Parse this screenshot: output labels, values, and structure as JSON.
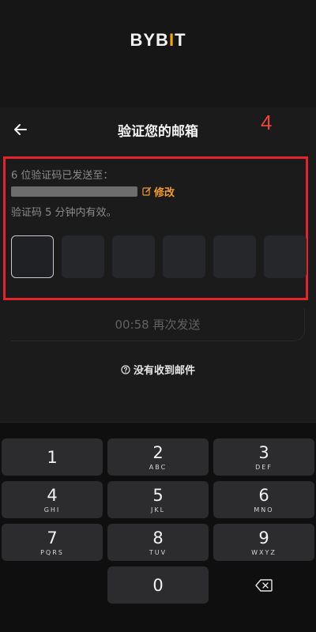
{
  "brand": {
    "logo_prefix": "BYB",
    "logo_accent": "I",
    "logo_suffix": "T"
  },
  "header": {
    "title": "验证您的邮箱",
    "annotation_number": "4"
  },
  "verification": {
    "sent_label": "6 位验证码已发送至：",
    "edit_label": "修改",
    "validity_note": "验证码 5 分钟内有效。",
    "code_length": 6
  },
  "resend": {
    "label": "00:58 再次发送"
  },
  "help": {
    "no_email_label": "没有收到邮件"
  },
  "keypad": {
    "keys": [
      {
        "digit": "1",
        "letters": ""
      },
      {
        "digit": "2",
        "letters": "ABC"
      },
      {
        "digit": "3",
        "letters": "DEF"
      },
      {
        "digit": "4",
        "letters": "GHI"
      },
      {
        "digit": "5",
        "letters": "JKL"
      },
      {
        "digit": "6",
        "letters": "MNO"
      },
      {
        "digit": "7",
        "letters": "PQRS"
      },
      {
        "digit": "8",
        "letters": "TUV"
      },
      {
        "digit": "9",
        "letters": "WXYZ"
      },
      {
        "digit": "0",
        "letters": ""
      }
    ],
    "delete_icon": "backspace-icon"
  },
  "colors": {
    "accent_orange": "#f29a2c",
    "brand_yellow": "#f7a600",
    "annotation_red": "#e3242b"
  }
}
